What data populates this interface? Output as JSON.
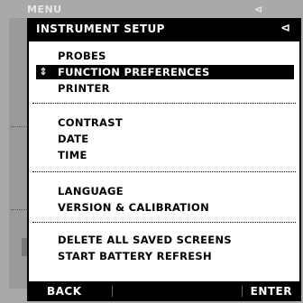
{
  "background": {
    "title": "MENU",
    "icon": "battery-plug-icon"
  },
  "dialog": {
    "title": "INSTRUMENT SETUP",
    "header_icon": "battery-plug-icon",
    "groups": [
      [
        "PROBES",
        "FUNCTION PREFERENCES",
        "PRINTER"
      ],
      [
        "CONTRAST",
        "DATE",
        "TIME"
      ],
      [
        "LANGUAGE",
        "VERSION & CALIBRATION"
      ],
      [
        "DELETE ALL SAVED SCREENS",
        "START BATTERY REFRESH"
      ]
    ],
    "selected_item": "FUNCTION PREFERENCES",
    "selection_icon": "up-down-arrow-icon"
  },
  "footer": {
    "back_label": "BACK",
    "enter_label": "ENTER"
  },
  "colors": {
    "dialog_frame": "#000000",
    "dialog_body": "#ffffff",
    "dimmed_background": "#a9a9a9"
  }
}
